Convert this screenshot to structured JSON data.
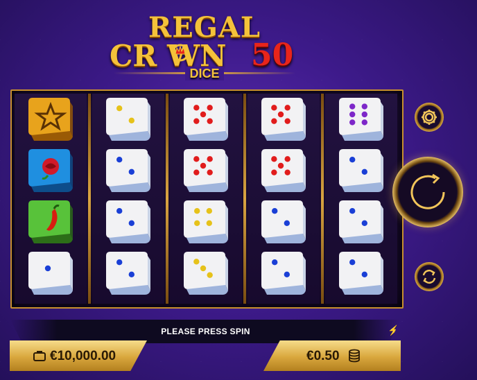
{
  "logo": {
    "line1": "REGAL",
    "line2": "CR  WN",
    "number": "50",
    "line3": "DICE"
  },
  "reels": [
    [
      "star-die",
      "rose-die",
      "chili-die",
      "dice-1-blue"
    ],
    [
      "dice-2-yellow",
      "dice-2-blue",
      "dice-2-blue",
      "dice-2-blue"
    ],
    [
      "dice-5-red",
      "dice-5-red",
      "dice-4-yellow",
      "dice-3-yellow"
    ],
    [
      "dice-5-red",
      "dice-5-red",
      "dice-2-blue",
      "dice-2-blue"
    ],
    [
      "dice-6-purple",
      "dice-2-blue",
      "dice-2-blue",
      "dice-2-blue"
    ]
  ],
  "status": {
    "message": "PLEASE PRESS SPIN"
  },
  "balance": {
    "amount": "€10,000.00",
    "icon": "wallet-icon"
  },
  "bet": {
    "amount": "€0.50",
    "icon": "coins-icon"
  },
  "colors": {
    "gold": "#f4c23a",
    "red": "#e8251b",
    "background": "#3d1a8a"
  }
}
